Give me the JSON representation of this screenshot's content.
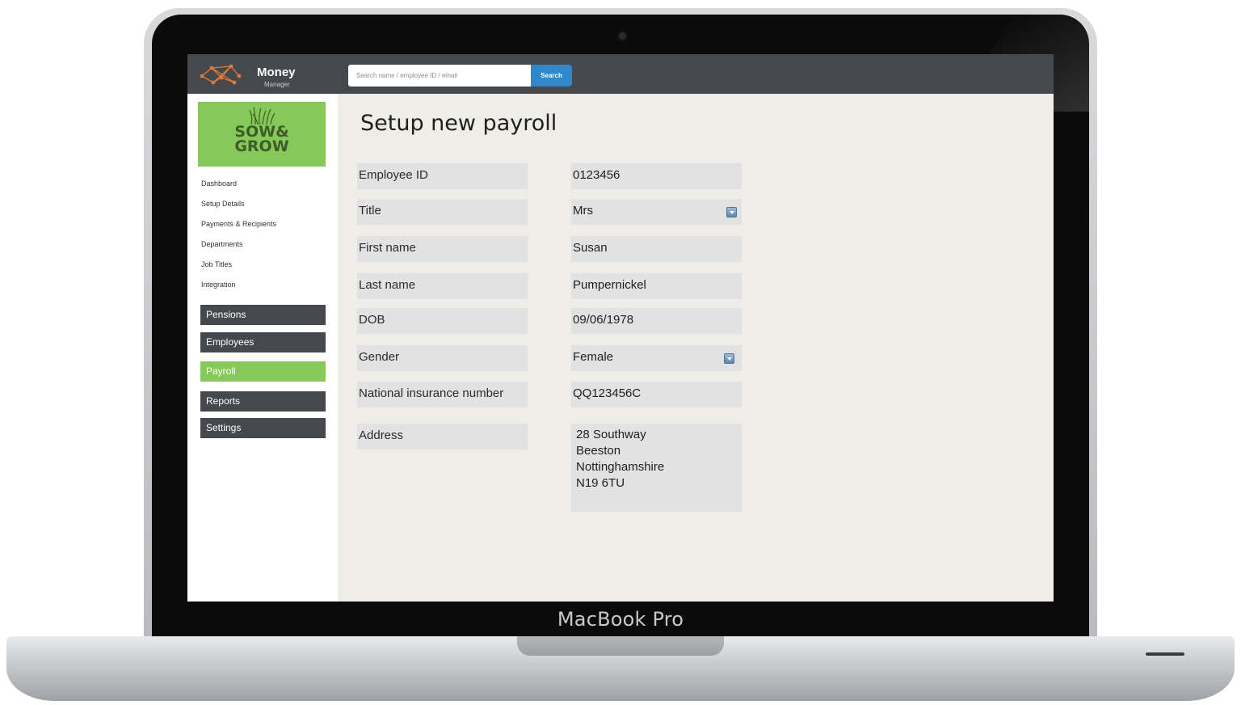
{
  "device": {
    "brand_label": "MacBook Pro"
  },
  "app": {
    "logo_word": "Money",
    "logo_sub": "Manager"
  },
  "search": {
    "placeholder": "Search name / employee ID / email",
    "button_label": "Search"
  },
  "company": {
    "logo_text_line1": "SOW&",
    "logo_text_line2": "GROW"
  },
  "sidebar": {
    "links": [
      "Dashboard",
      "Setup Details",
      "Payments & Recipients",
      "Departments",
      "Job Titles",
      "Integration"
    ],
    "buttons": [
      {
        "label": "Pensions",
        "active": false
      },
      {
        "label": "Employees",
        "active": false
      },
      {
        "label": "Payroll",
        "active": true
      },
      {
        "label": "Reports",
        "active": false
      },
      {
        "label": "Settings",
        "active": false
      }
    ]
  },
  "colors": {
    "accent_green": "#86c95a",
    "dark_bar": "#45494e",
    "search_blue": "#2f88c9"
  },
  "main": {
    "title": "Setup new payroll",
    "fields": [
      {
        "label": "Employee ID",
        "value": "0123456",
        "type": "text"
      },
      {
        "label": "Title",
        "value": "Mrs",
        "type": "select"
      },
      {
        "label": "First name",
        "value": "Susan",
        "type": "text"
      },
      {
        "label": "Last name",
        "value": "Pumpernickel",
        "type": "text"
      },
      {
        "label": "DOB",
        "value": "09/06/1978",
        "type": "text"
      },
      {
        "label": "Gender",
        "value": "Female",
        "type": "select"
      },
      {
        "label": "National insurance number",
        "value": "QQ123456C",
        "type": "text"
      }
    ],
    "address": {
      "label": "Address",
      "lines": [
        "28 Southway",
        "Beeston",
        "Nottinghamshire",
        "N19 6TU"
      ]
    }
  }
}
